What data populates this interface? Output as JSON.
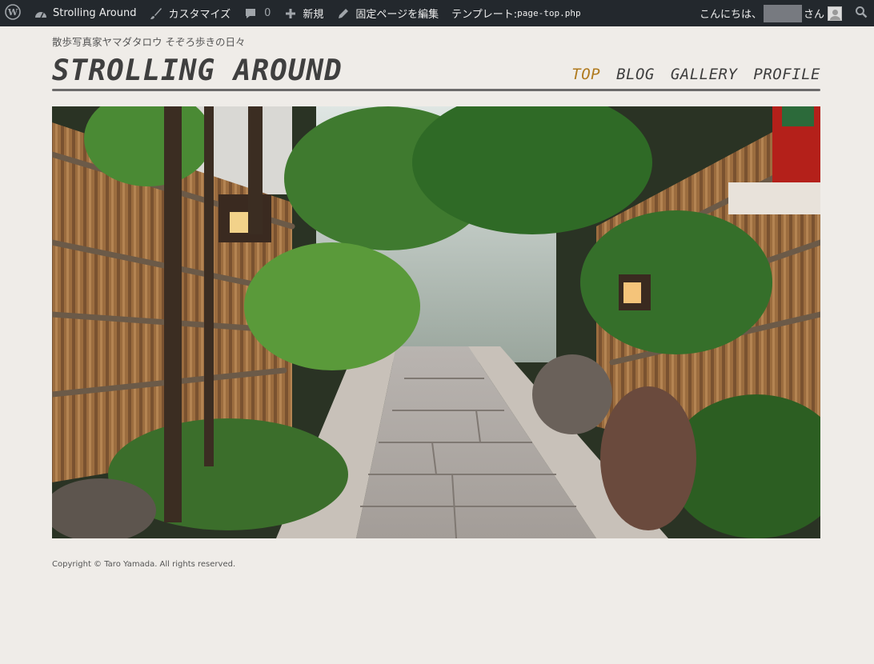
{
  "adminbar": {
    "site_name": "Strolling Around",
    "customize": "カスタマイズ",
    "comments_count": "0",
    "new": "新規",
    "edit_page": "固定ページを編集",
    "template_label": "テンプレート:",
    "template_file": "page-top.php",
    "greeting": "こんにちは、",
    "san": "さん"
  },
  "header": {
    "tagline": "散歩写真家ヤマダタロウ そぞろ歩きの日々",
    "logo": "STROLLING AROUND"
  },
  "nav": {
    "items": [
      "TOP",
      "BLOG",
      "GALLERY",
      "PROFILE"
    ],
    "active_color": "#b07a1e"
  },
  "footer": {
    "copyright": "Copyright © Taro Yamada. All rights reserved."
  }
}
